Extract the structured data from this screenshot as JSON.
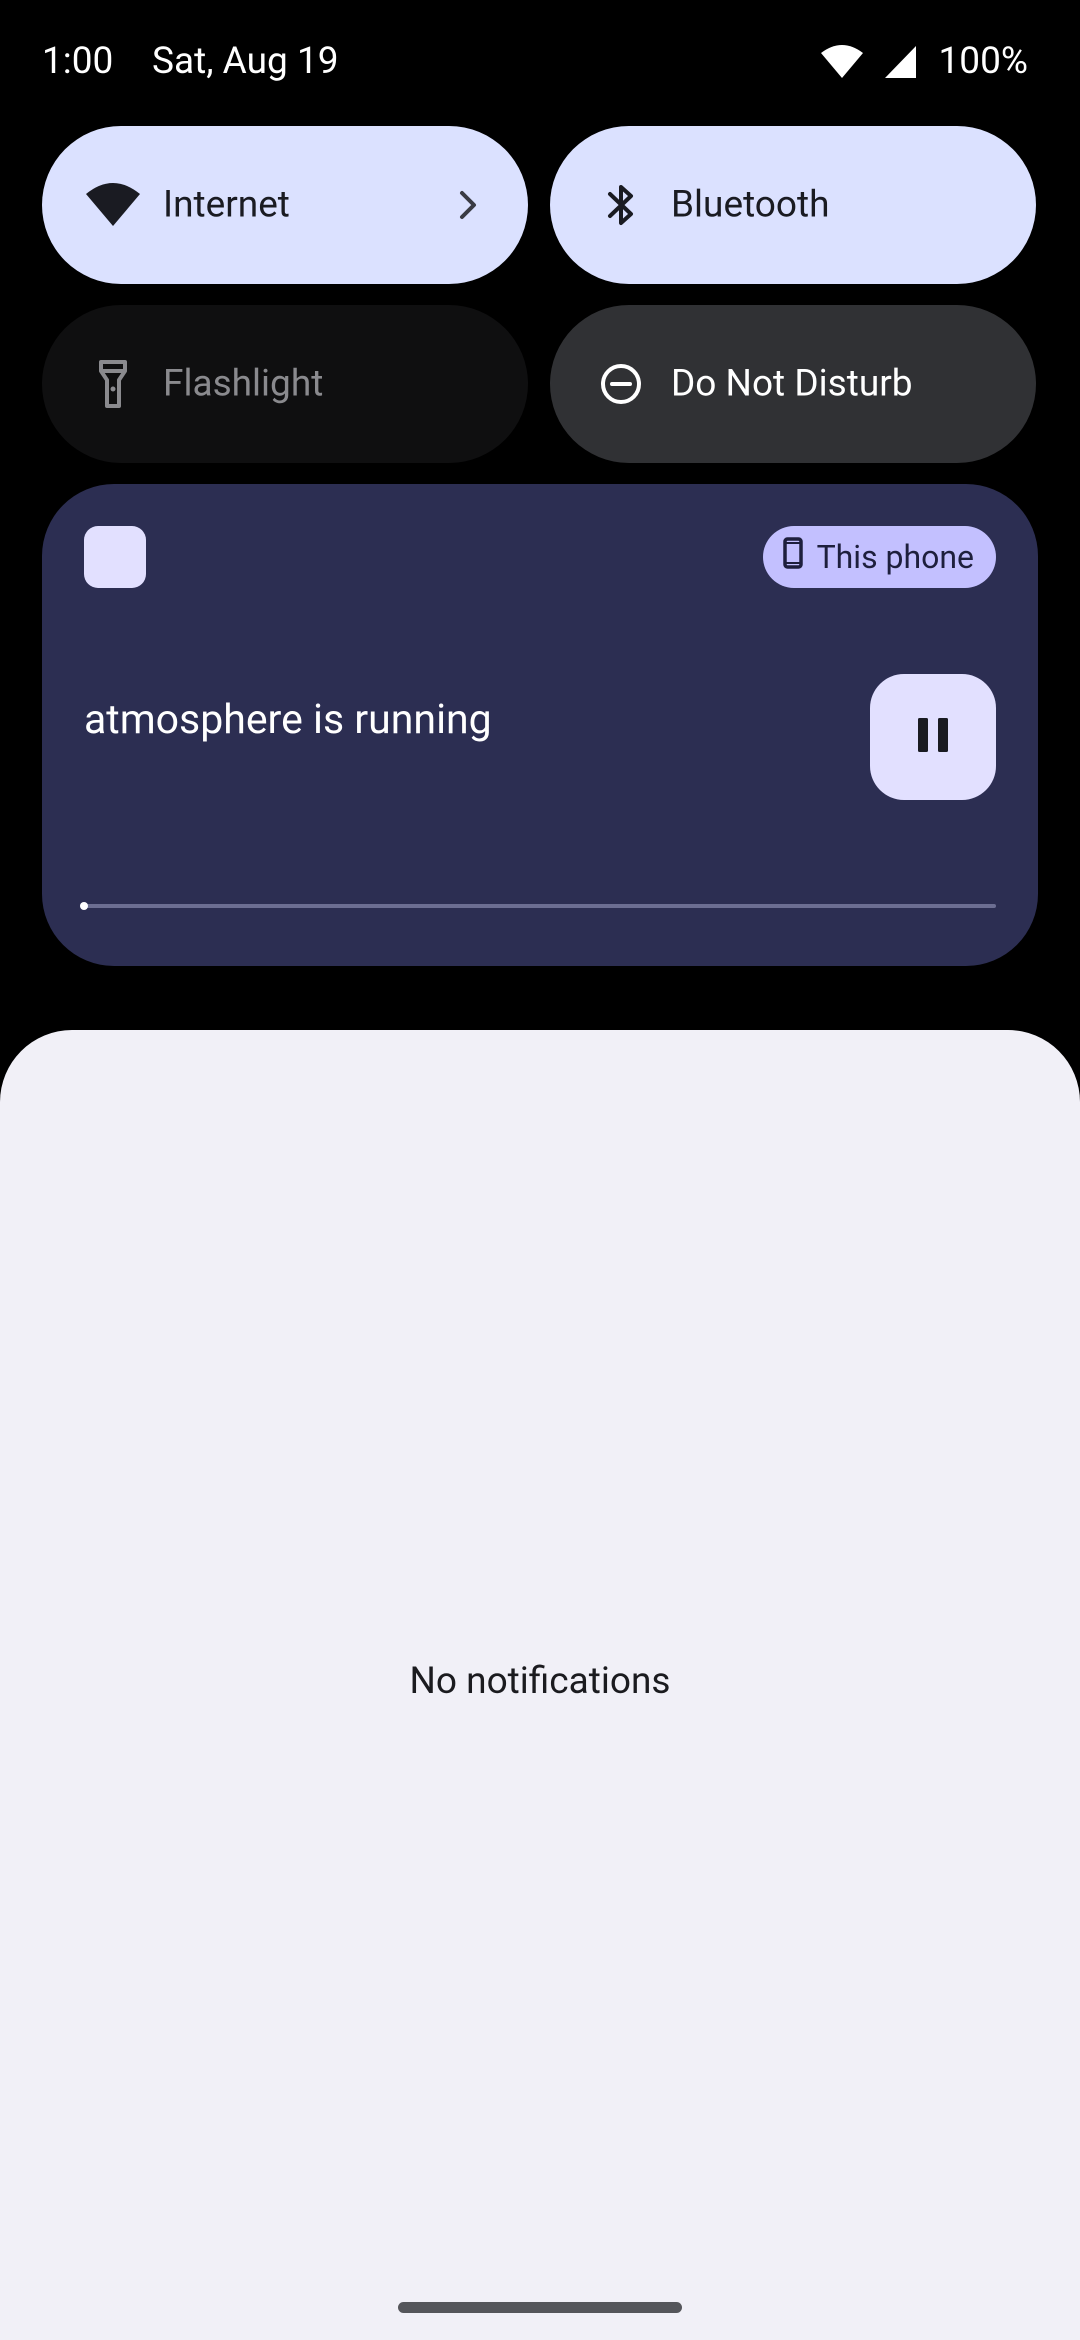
{
  "status_bar": {
    "time": "1:00",
    "date": "Sat, Aug 19",
    "battery": "100%",
    "icons": [
      "wifi-icon",
      "cell-signal-icon"
    ]
  },
  "quick_settings": {
    "tiles": [
      {
        "label": "Internet",
        "icon": "wifi-icon",
        "state": "on",
        "has_chevron": true
      },
      {
        "label": "Bluetooth",
        "icon": "bluetooth-icon",
        "state": "on"
      },
      {
        "label": "Flashlight",
        "icon": "flashlight-icon",
        "state": "unavailable"
      },
      {
        "label": "Do Not Disturb",
        "icon": "do-not-disturb-icon",
        "state": "off"
      }
    ]
  },
  "media": {
    "title": "atmosphere is running",
    "output_device": "This phone",
    "output_icon": "phone-icon",
    "control": "pause-icon",
    "progress": 0.0
  },
  "notifications": {
    "empty_text": "No notifications"
  },
  "colors": {
    "tile_active": "#dbe1ff",
    "tile_inactive": "#303134",
    "media_background": "#2c2e52",
    "shade_background": "#f1f0f7"
  }
}
